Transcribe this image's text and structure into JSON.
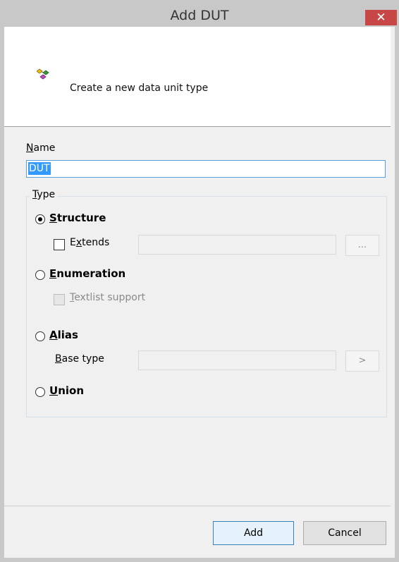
{
  "window": {
    "title": "Add DUT",
    "close_glyph": "✕"
  },
  "header": {
    "icon": "dut-icon",
    "description": "Create a new data unit type"
  },
  "name": {
    "label_access": "N",
    "label_rest": "ame",
    "value": "DUT"
  },
  "type_group": {
    "legend_access": "T",
    "legend_rest": "ype",
    "structure": {
      "label_access": "S",
      "label_rest": "tructure",
      "selected": true,
      "extends": {
        "label_pre": "E",
        "label_access": "x",
        "label_rest": "tends",
        "checked": false,
        "browse_label": "..."
      }
    },
    "enumeration": {
      "label_access": "E",
      "label_rest": "numeration",
      "selected": false,
      "textlist": {
        "label_access": "T",
        "label_rest": "extlist support",
        "checked": false,
        "enabled": false
      }
    },
    "alias": {
      "label_access": "A",
      "label_rest": "lias",
      "selected": false,
      "base_type": {
        "label_access": "B",
        "label_rest": "ase type",
        "browse_label": ">"
      }
    },
    "union": {
      "label_access": "U",
      "label_rest": "nion",
      "selected": false
    }
  },
  "buttons": {
    "add": "Add",
    "cancel": "Cancel"
  },
  "colors": {
    "titlebar": "#c8c8c8",
    "close": "#c74747",
    "selection": "#3399ff",
    "focus_border": "#56a0dc"
  }
}
